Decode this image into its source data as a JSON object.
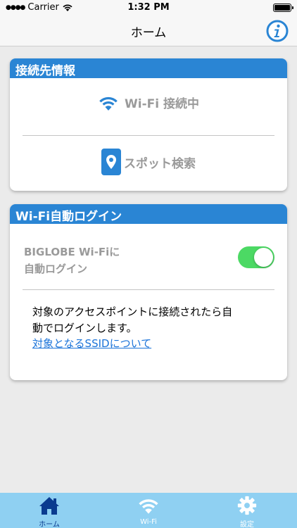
{
  "status": {
    "carrier": "Carrier",
    "time": "1:32 PM"
  },
  "nav": {
    "title": "ホーム"
  },
  "connection_card": {
    "header": "接続先情報",
    "wifi_status": "Wi-Fi 接続中",
    "spot_search": "スポット検索"
  },
  "login_card": {
    "header": "Wi-Fi自動ログイン",
    "toggle_label_line1": "BIGLOBE Wi-Fiに",
    "toggle_label_line2": "自動ログイン",
    "toggle_on": true,
    "description_line1": "対象のアクセスポイントに接続されたら自",
    "description_line2": "動でログインします。",
    "link": "対象となるSSIDについて"
  },
  "tabs": [
    {
      "label": "ホーム",
      "icon": "home-icon",
      "active": true
    },
    {
      "label": "Wi-Fi",
      "icon": "wifi-icon",
      "active": false
    },
    {
      "label": "設定",
      "icon": "gear-icon",
      "active": false
    }
  ],
  "colors": {
    "accent": "#2a85d4",
    "toggle": "#4cd964",
    "tab_bar": "#8fd0f2",
    "link": "#1a73d9"
  }
}
